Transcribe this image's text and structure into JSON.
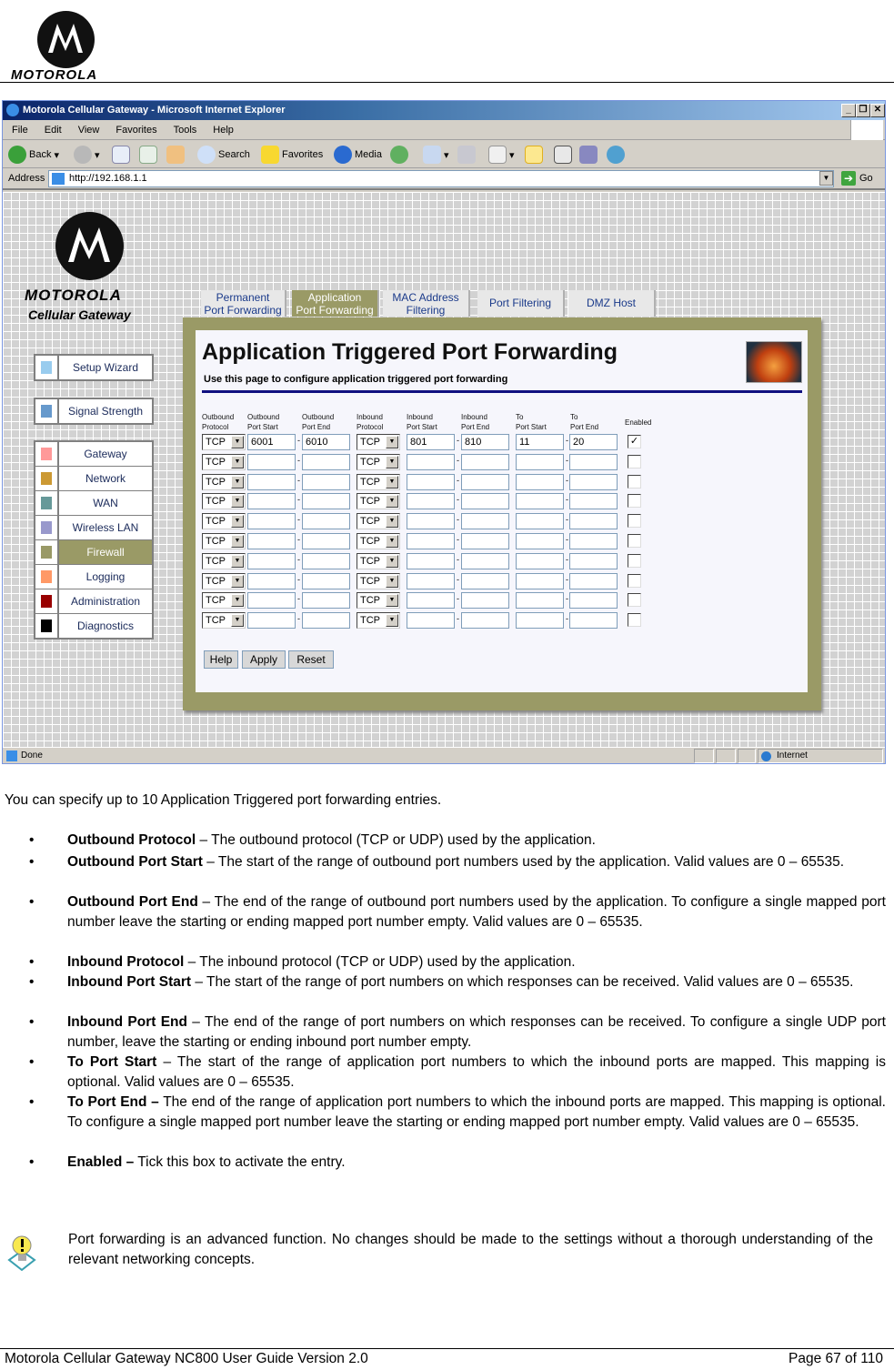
{
  "document": {
    "logo_text": "MOTOROLA",
    "intro": "You can specify up to 10 Application Triggered port forwarding entries.",
    "bullets": [
      {
        "term": "Outbound Protocol",
        "desc": " – The outbound protocol (TCP or UDP) used by the application."
      },
      {
        "term": "Outbound Port Start",
        "desc": " – The start of the range of outbound port numbers used by the application. Valid values are 0 – 65535."
      },
      {
        "term": "Outbound Port End",
        "desc": " – The end of the range of outbound port numbers used by the application. To configure a single mapped port number leave the starting or ending mapped port number empty. Valid values are 0 – 65535."
      },
      {
        "term": "Inbound Protocol",
        "desc": " – The inbound protocol (TCP or UDP) used by the application."
      },
      {
        "term": "Inbound Port Start",
        "desc": " – The start of the range of port numbers on which responses can be received. Valid values are 0 – 65535."
      },
      {
        "term": "Inbound Port End",
        "desc": " – The end of the range of port numbers on which responses can be received. To configure a single UDP port number, leave the starting or ending inbound port number empty."
      },
      {
        "term": "To Port Start",
        "desc": " – The start of the range of application port numbers to which the inbound ports are mapped. This mapping is optional. Valid values are 0 – 65535."
      },
      {
        "term": "To Port End –",
        "desc": " The end of the range of application port numbers to which the inbound ports are mapped. This mapping is optional. To configure a single mapped port number leave the starting or ending mapped port number empty. Valid values are 0 – 65535."
      },
      {
        "term": "Enabled –",
        "desc": " Tick this box to activate the entry."
      }
    ],
    "note": "Port forwarding is an advanced function. No changes should be made to the settings without a thorough understanding of the relevant networking concepts.",
    "footer_left": "Motorola Cellular Gateway NC800 User Guide Version 2.0",
    "footer_right": "Page 67 of 110"
  },
  "browser": {
    "title": "Motorola Cellular Gateway - Microsoft Internet Explorer",
    "menu": [
      "File",
      "Edit",
      "View",
      "Favorites",
      "Tools",
      "Help"
    ],
    "toolbar": {
      "back": "Back",
      "search": "Search",
      "favorites": "Favorites",
      "media": "Media"
    },
    "address_label": "Address",
    "address": "http://192.168.1.1",
    "go": "Go",
    "status": "Done",
    "zone": "Internet"
  },
  "app": {
    "brand": "MOTOROLA",
    "subtitle": "Cellular Gateway",
    "nav_groups": [
      [
        {
          "label": "Setup Wizard",
          "color": "#99ccee"
        }
      ],
      [
        {
          "label": "Signal Strength",
          "color": "#6699cc"
        }
      ],
      [
        {
          "label": "Gateway",
          "color": "#ff9999"
        },
        {
          "label": "Network",
          "color": "#cc9933"
        },
        {
          "label": "WAN",
          "color": "#669999"
        },
        {
          "label": "Wireless LAN",
          "color": "#9999cc"
        },
        {
          "label": "Firewall",
          "color": "#999966",
          "active": true
        },
        {
          "label": "Logging",
          "color": "#ff9966"
        },
        {
          "label": "Administration",
          "color": "#990000"
        },
        {
          "label": "Diagnostics",
          "color": "#000000"
        }
      ]
    ],
    "tabs": [
      {
        "l1": "Permanent",
        "l2": "Port Forwarding"
      },
      {
        "l1": "Application",
        "l2": "Port Forwarding",
        "active": true
      },
      {
        "l1": "MAC Address",
        "l2": "Filtering"
      },
      {
        "l1": "Port Filtering",
        "l2": ""
      },
      {
        "l1": "DMZ Host",
        "l2": ""
      }
    ],
    "page_title": "Application Triggered Port Forwarding",
    "page_subtitle": "Use this page to configure application triggered port forwarding",
    "columns": [
      [
        "Outbound",
        "Protocol"
      ],
      [
        "Outbound",
        "Port Start"
      ],
      [
        "Outbound",
        "Port End"
      ],
      [
        "Inbound",
        "Protocol"
      ],
      [
        "Inbound",
        "Port Start"
      ],
      [
        "Inbound",
        "Port End"
      ],
      [
        "To",
        "Port Start"
      ],
      [
        "To",
        "Port End"
      ],
      [
        "Enabled",
        ""
      ]
    ],
    "rows": [
      {
        "out_proto": "TCP",
        "out_start": "6001",
        "out_end": "6010",
        "in_proto": "TCP",
        "in_start": "801",
        "in_end": "810",
        "to_start": "11",
        "to_end": "20",
        "enabled": true
      },
      {
        "out_proto": "TCP",
        "out_start": "",
        "out_end": "",
        "in_proto": "TCP",
        "in_start": "",
        "in_end": "",
        "to_start": "",
        "to_end": "",
        "enabled": false
      },
      {
        "out_proto": "TCP",
        "out_start": "",
        "out_end": "",
        "in_proto": "TCP",
        "in_start": "",
        "in_end": "",
        "to_start": "",
        "to_end": "",
        "enabled": false
      },
      {
        "out_proto": "TCP",
        "out_start": "",
        "out_end": "",
        "in_proto": "TCP",
        "in_start": "",
        "in_end": "",
        "to_start": "",
        "to_end": "",
        "enabled": false
      },
      {
        "out_proto": "TCP",
        "out_start": "",
        "out_end": "",
        "in_proto": "TCP",
        "in_start": "",
        "in_end": "",
        "to_start": "",
        "to_end": "",
        "enabled": false
      },
      {
        "out_proto": "TCP",
        "out_start": "",
        "out_end": "",
        "in_proto": "TCP",
        "in_start": "",
        "in_end": "",
        "to_start": "",
        "to_end": "",
        "enabled": false
      },
      {
        "out_proto": "TCP",
        "out_start": "",
        "out_end": "",
        "in_proto": "TCP",
        "in_start": "",
        "in_end": "",
        "to_start": "",
        "to_end": "",
        "enabled": false
      },
      {
        "out_proto": "TCP",
        "out_start": "",
        "out_end": "",
        "in_proto": "TCP",
        "in_start": "",
        "in_end": "",
        "to_start": "",
        "to_end": "",
        "enabled": false
      },
      {
        "out_proto": "TCP",
        "out_start": "",
        "out_end": "",
        "in_proto": "TCP",
        "in_start": "",
        "in_end": "",
        "to_start": "",
        "to_end": "",
        "enabled": false
      },
      {
        "out_proto": "TCP",
        "out_start": "",
        "out_end": "",
        "in_proto": "TCP",
        "in_start": "",
        "in_end": "",
        "to_start": "",
        "to_end": "",
        "enabled": false
      }
    ],
    "buttons": {
      "help": "Help",
      "apply": "Apply",
      "reset": "Reset"
    }
  }
}
